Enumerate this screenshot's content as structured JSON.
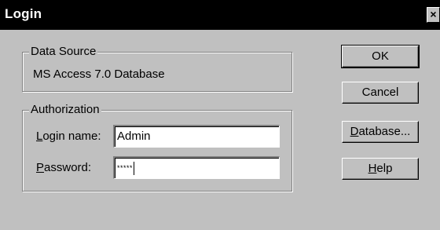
{
  "window": {
    "title": "Login",
    "close_glyph": "×"
  },
  "data_source": {
    "legend": "Data Source",
    "value": "MS Access 7.0 Database"
  },
  "authorization": {
    "legend": "Authorization",
    "login_name": {
      "label_mnemonic": "L",
      "label_rest": "ogin name:",
      "value": "Admin"
    },
    "password": {
      "label_mnemonic": "P",
      "label_rest": "assword:",
      "value": "*****"
    }
  },
  "buttons": {
    "ok": "OK",
    "cancel": "Cancel",
    "database_mnemonic": "D",
    "database_rest": "atabase...",
    "help_mnemonic": "H",
    "help_rest": "elp"
  },
  "icons": {
    "close": "close-icon"
  }
}
